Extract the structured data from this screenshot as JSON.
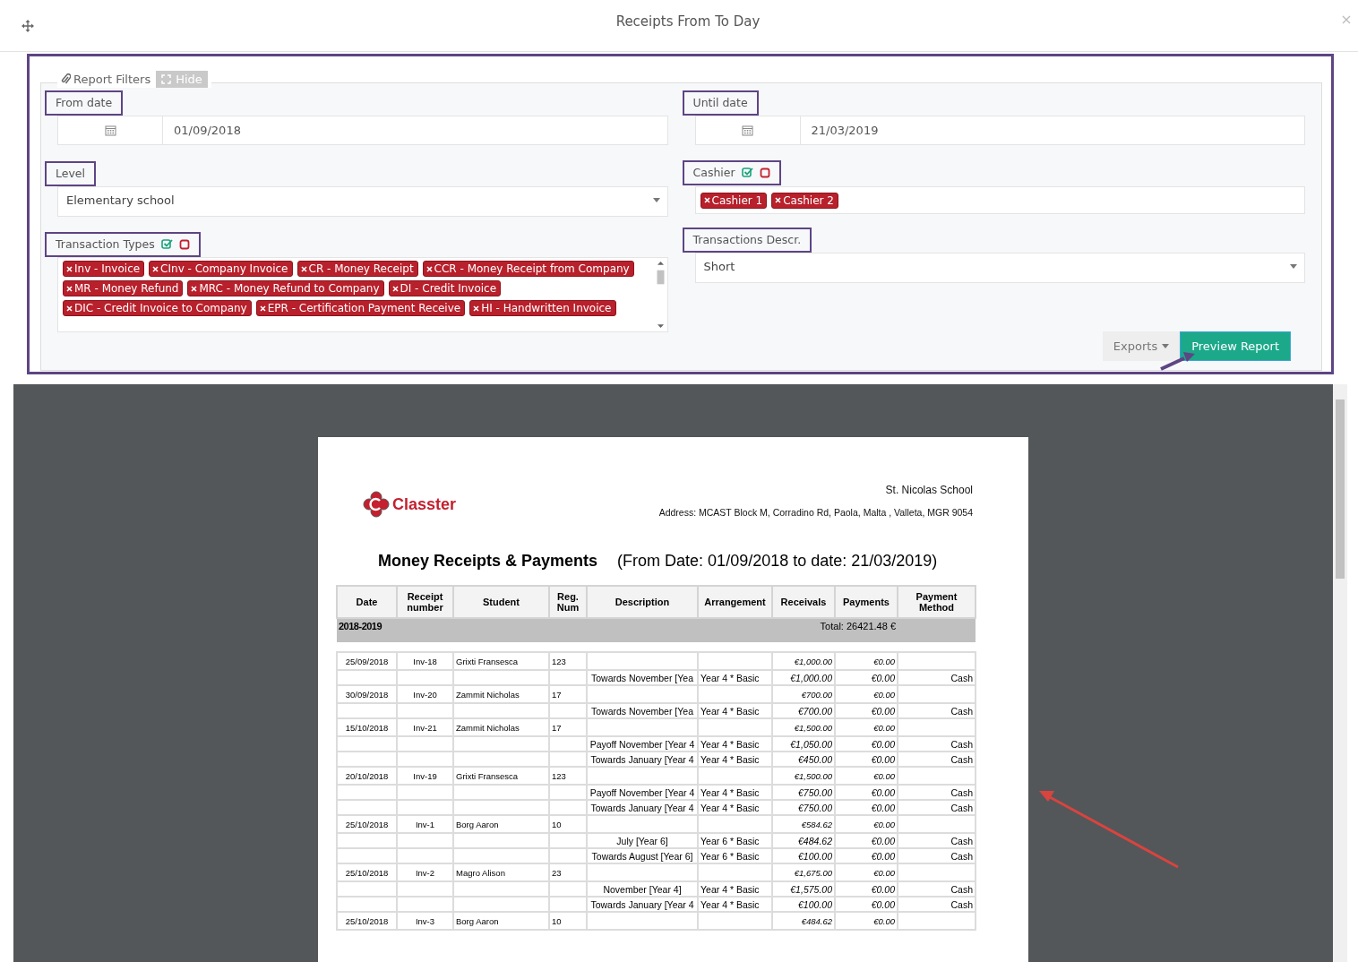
{
  "window": {
    "title": "Receipts From To Day"
  },
  "filters": {
    "legend": "Report Filters",
    "hide_button": "Hide",
    "from_date": {
      "label": "From date",
      "value": "01/09/2018"
    },
    "until_date": {
      "label": "Until date",
      "value": "21/03/2019"
    },
    "level": {
      "label": "Level",
      "value": "Elementary school"
    },
    "cashier": {
      "label": "Cashier",
      "tags": [
        "Cashier 1",
        "Cashier 2"
      ]
    },
    "transaction_types": {
      "label": "Transaction Types",
      "tags": [
        "Inv - Invoice",
        "CInv - Company Invoice",
        "CR - Money Receipt",
        "CCR - Money Receipt from Company",
        "MR - Money Refund",
        "MRC - Money Refund to Company",
        "DI - Credit Invoice",
        "DIC - Credit Invoice to Company",
        "EPR - Certification Payment Receive",
        "HI - Handwritten Invoice"
      ]
    },
    "transactions_descr": {
      "label": "Transactions Descr.",
      "value": "Short"
    },
    "exports_button": "Exports",
    "preview_button": "Preview Report"
  },
  "report": {
    "logo_text": "Classter",
    "school": "St. Nicolas School",
    "address": "Address: MCAST Block M, Corradino Rd, Paola, Malta , Valleta, MGR 9054",
    "title": "Money Receipts & Payments",
    "date_range": "(From Date: 01/09/2018 to date: 21/03/2019)",
    "columns": [
      "Date",
      "Receipt number",
      "Student",
      "Reg. Num",
      "Description",
      "Arrangement",
      "Receivals",
      "Payments",
      "Payment Method"
    ],
    "group": {
      "label": "2018-2019",
      "total": "Total: 26421.48 €"
    },
    "rows": [
      {
        "kind": "receipt",
        "date": "25/09/2018",
        "receipt": "Inv-18",
        "student": "Grixti Fransesca",
        "reg": "123",
        "receivals": "€1,000.00",
        "payments": "€0.00"
      },
      {
        "kind": "line",
        "description": "Towards November [Yea",
        "arrangement": "Year 4 * Basic",
        "receivals": "€1,000.00",
        "payments": "€0.00",
        "method": "Cash"
      },
      {
        "kind": "receipt",
        "date": "30/09/2018",
        "receipt": "Inv-20",
        "student": "Zammit Nicholas",
        "reg": "17",
        "receivals": "€700.00",
        "payments": "€0.00"
      },
      {
        "kind": "line",
        "description": "Towards November [Yea",
        "arrangement": "Year 4 * Basic",
        "receivals": "€700.00",
        "payments": "€0.00",
        "method": "Cash"
      },
      {
        "kind": "receipt",
        "date": "15/10/2018",
        "receipt": "Inv-21",
        "student": "Zammit Nicholas",
        "reg": "17",
        "receivals": "€1,500.00",
        "payments": "€0.00"
      },
      {
        "kind": "line",
        "description": "Payoff November [Year 4",
        "arrangement": "Year 4 * Basic",
        "receivals": "€1,050.00",
        "payments": "€0.00",
        "method": "Cash"
      },
      {
        "kind": "line",
        "description": "Towards January [Year 4",
        "arrangement": "Year 4 * Basic",
        "receivals": "€450.00",
        "payments": "€0.00",
        "method": "Cash"
      },
      {
        "kind": "receipt",
        "date": "20/10/2018",
        "receipt": "Inv-19",
        "student": "Grixti Fransesca",
        "reg": "123",
        "receivals": "€1,500.00",
        "payments": "€0.00"
      },
      {
        "kind": "line",
        "description": "Payoff November [Year 4",
        "arrangement": "Year 4 * Basic",
        "receivals": "€750.00",
        "payments": "€0.00",
        "method": "Cash"
      },
      {
        "kind": "line",
        "description": "Towards January [Year 4",
        "arrangement": "Year 4 * Basic",
        "receivals": "€750.00",
        "payments": "€0.00",
        "method": "Cash"
      },
      {
        "kind": "receipt",
        "date": "25/10/2018",
        "receipt": "Inv-1",
        "student": "Borg Aaron",
        "reg": "10",
        "receivals": "€584.62",
        "payments": "€0.00"
      },
      {
        "kind": "line",
        "description": "July [Year 6]",
        "arrangement": "Year 6 * Basic",
        "receivals": "€484.62",
        "payments": "€0.00",
        "method": "Cash"
      },
      {
        "kind": "line",
        "description": "Towards August [Year 6]",
        "arrangement": "Year 6 * Basic",
        "receivals": "€100.00",
        "payments": "€0.00",
        "method": "Cash"
      },
      {
        "kind": "receipt",
        "date": "25/10/2018",
        "receipt": "Inv-2",
        "student": "Magro Alison",
        "reg": "23",
        "receivals": "€1,675.00",
        "payments": "€0.00"
      },
      {
        "kind": "line",
        "description": "November [Year 4]",
        "arrangement": "Year 4 * Basic",
        "receivals": "€1,575.00",
        "payments": "€0.00",
        "method": "Cash"
      },
      {
        "kind": "line",
        "description": "Towards January [Year 4",
        "arrangement": "Year 4 * Basic",
        "receivals": "€100.00",
        "payments": "€0.00",
        "method": "Cash"
      },
      {
        "kind": "receipt",
        "date": "25/10/2018",
        "receipt": "Inv-3",
        "student": "Borg Aaron",
        "reg": "10",
        "receivals": "€484.62",
        "payments": "€0.00"
      }
    ]
  }
}
